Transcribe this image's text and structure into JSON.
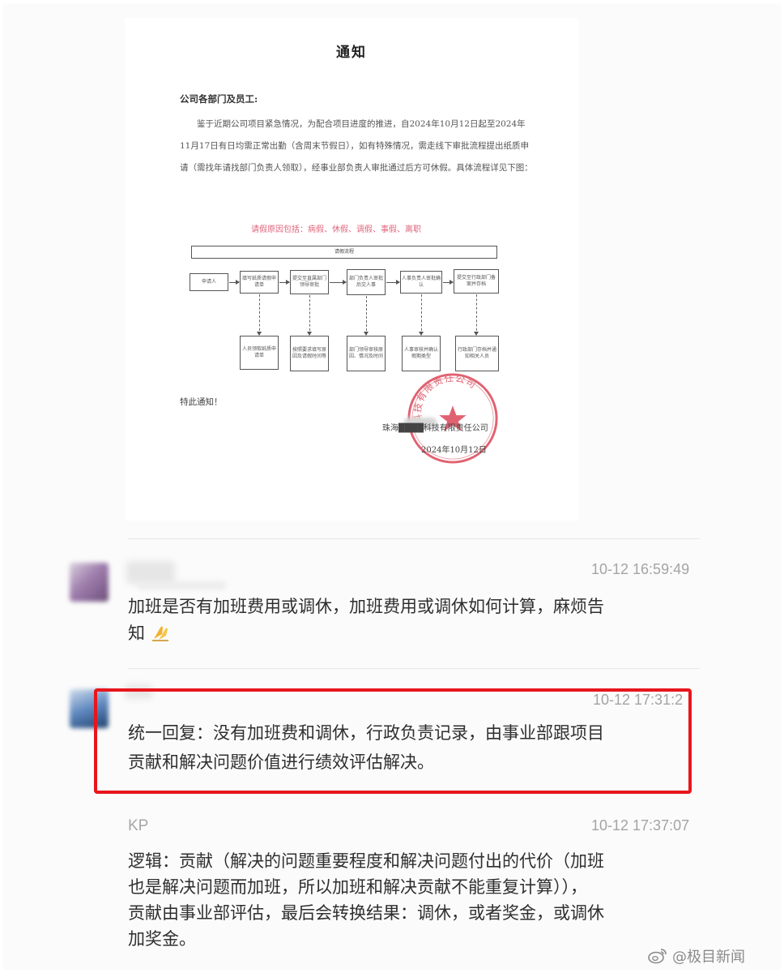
{
  "notice": {
    "title": "通知",
    "salutation": "公司各部门及员工:",
    "body": "鉴于近期公司项目紧急情况，为配合项目进度的推进，自2024年10月12日起至2024年11月17日有日均需正常出勤（含周末节假日），如有特殊情况，需走线下审批流程提出纸质申请（需找年请找部门负责人领取），经事业部负责人审批通过后方可休假。具体流程详见下图：",
    "flow_title": "请假原因包括：病假、休假、调假、事假、离职",
    "flow_bar_label": "请假流程",
    "flow_steps": [
      "申请人",
      "填写纸质请假申请单",
      "提交至直属部门领导审批",
      "部门负责人审批后交人事",
      "人事负责人审批确认",
      "提交至行政部门备案并存档"
    ],
    "flow_notes": [
      "人员领取纸质申请单",
      "按照要求填写原因及请假时间等",
      "部门领导审核原因、情况及时间",
      "人事审核并确认假期类型",
      "行政部门存档并通知相关人员"
    ],
    "closing": "特此通知！",
    "company": "珠海████科技有限责任公司",
    "date": "2024年10月12日",
    "seal_text": "科技有限责任公司"
  },
  "chat": {
    "messages": [
      {
        "sender": "",
        "timestamp": "10-12 16:59:49",
        "text": "加班是否有加班费用或调休，加班费用或调休如何计算，麻烦告知",
        "line2_prefix": "知",
        "emoji": "folded-hands-icon"
      },
      {
        "sender": "",
        "timestamp": "10-12 17:31:2",
        "line1": "统一回复：没有加班费和调休，行政负责记录，由事业部跟项目",
        "line2": "贡献和解决问题价值进行绩效评估解决。"
      },
      {
        "sender": "KP",
        "timestamp": "10-12 17:37:07",
        "lines": [
          "逻辑：贡献（解决的问题重要程度和解决问题付出的代价（加班",
          "也是解决问题而加班，所以加班和解决贡献不能重复计算）），",
          "贡献由事业部评估，最后会转换结果：调休，或者奖金，或调休",
          "加奖金。"
        ]
      }
    ],
    "highlight_color": "#e8161c"
  },
  "watermark": {
    "text": "@极目新闻",
    "logo": "weibo-logo-icon"
  }
}
